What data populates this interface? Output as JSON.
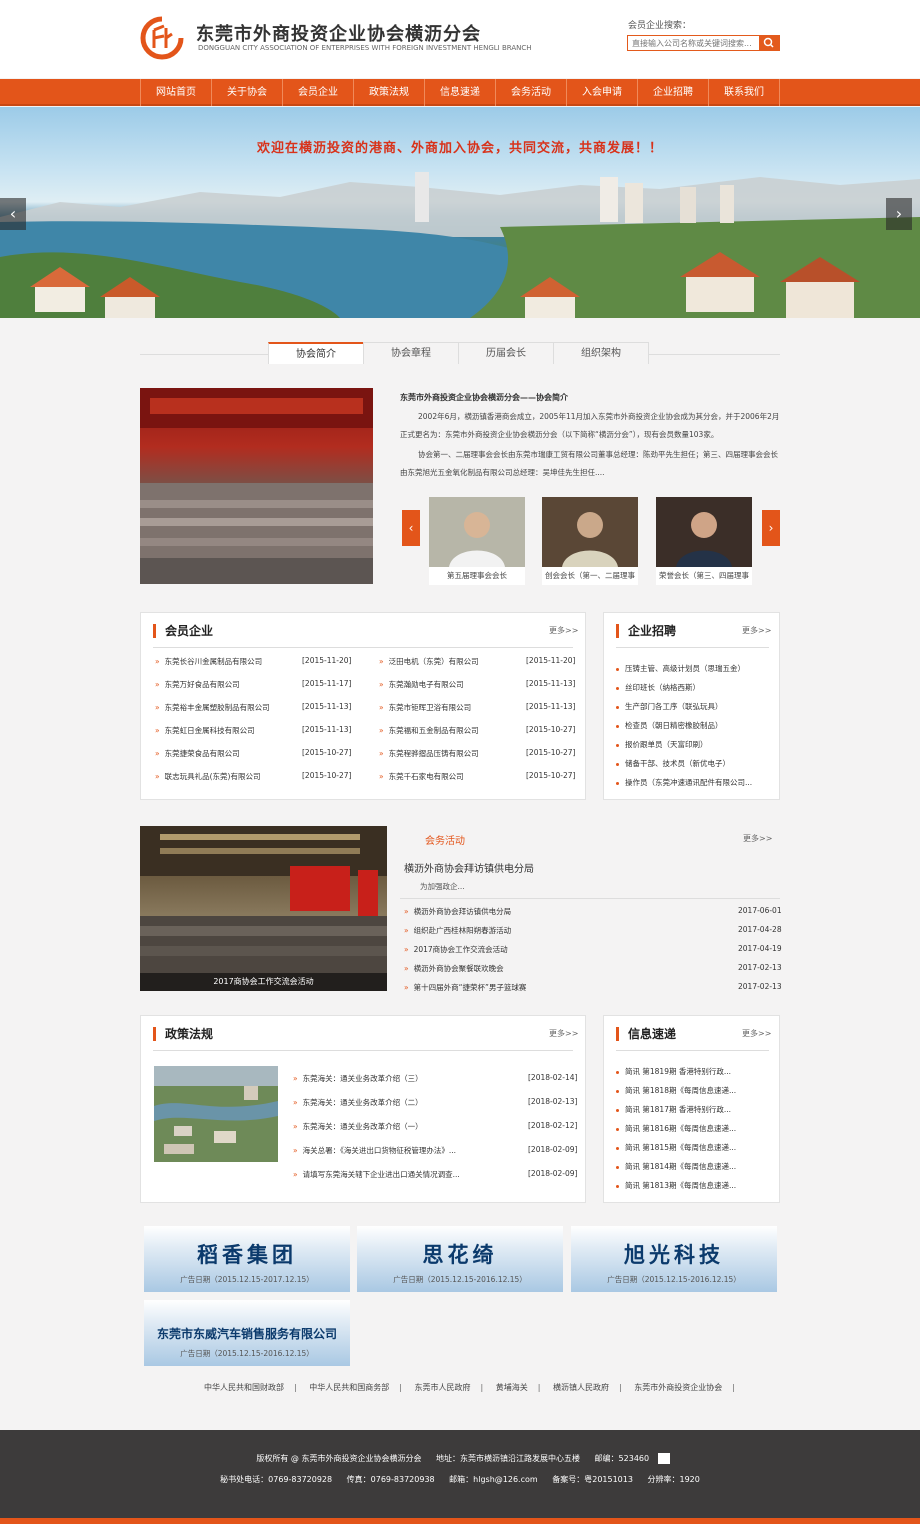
{
  "header": {
    "title": "东莞市外商投资企业协会横沥分会",
    "subtitle": "DONGGUAN CITY ASSOCIATION OF ENTERPRISES WITH FOREIGN INVESTMENT HENGLI BRANCH",
    "search_label": "会员企业搜索：",
    "search_placeholder": "直接输入公司名称或关键词搜索..."
  },
  "nav": [
    "网站首页",
    "关于协会",
    "会员企业",
    "政策法规",
    "信息速递",
    "会务活动",
    "入会申请",
    "企业招聘",
    "联系我们"
  ],
  "banner": {
    "slogan": "欢迎在横沥投资的港商、外商加入协会，共同交流，共商发展！！"
  },
  "tabs": [
    "协会简介",
    "协会章程",
    "历届会长",
    "组织架构"
  ],
  "intro": {
    "title": "东莞市外商投资企业协会横沥分会——协会简介",
    "p1": "2002年6月，横沥镇香港商会成立，2005年11月加入东莞市外商投资企业协会成为其分会，并于2006年2月正式更名为：东莞市外商投资企业协会横沥分会（以下简称“横沥分会”），现有会员数量103家。",
    "p2": "协会第一、二届理事会会长由东莞市瑞康工贸有限公司董事总经理：陈劲平先生担任；第三、四届理事会会长由东莞旭光五金氧化制品有限公司总经理：吴坤佳先生担任....",
    "people": [
      "第五届理事会会长",
      "创会会长（第一、二届理事",
      "荣誉会长（第三、四届理事"
    ]
  },
  "members": {
    "title": "会员企业",
    "more": "更多>>",
    "left": [
      {
        "name": "东莞长谷川金属制品有限公司",
        "date": "[2015-11-20]"
      },
      {
        "name": "东莞万好食品有限公司",
        "date": "[2015-11-17]"
      },
      {
        "name": "东莞裕丰金属塑胶制品有限公司",
        "date": "[2015-11-13]"
      },
      {
        "name": "东莞虹日金属科技有限公司",
        "date": "[2015-11-13]"
      },
      {
        "name": "东莞捷荣食品有限公司",
        "date": "[2015-10-27]"
      },
      {
        "name": "联志玩具礼品(东莞)有限公司",
        "date": "[2015-10-27]"
      }
    ],
    "right": [
      {
        "name": "泛田电机（东莞）有限公司",
        "date": "[2015-11-20]"
      },
      {
        "name": "东莞瀚勋电子有限公司",
        "date": "[2015-11-13]"
      },
      {
        "name": "东莞市钜晖卫浴有限公司",
        "date": "[2015-11-13]"
      },
      {
        "name": "东莞福和五金制品有限公司",
        "date": "[2015-10-27]"
      },
      {
        "name": "东莞程骅摺品压铸有限公司",
        "date": "[2015-10-27]"
      },
      {
        "name": "东莞千石家电有限公司",
        "date": "[2015-10-27]"
      }
    ]
  },
  "jobs": {
    "title": "企业招聘",
    "more": "更多>>",
    "items": [
      "压铸主管、高级计划员（思瑞五金）",
      "丝印班长（纳格西斯）",
      "生产部门各工序（联弘玩具）",
      "检查员（朝日精密橡胶制品）",
      "报价跟单员（天富印刷）",
      "储备干部、技术员（新优电子）",
      "操作员（东莞冲速通讯配件有限公司..."
    ]
  },
  "activities": {
    "title": "会务活动",
    "more": "更多>>",
    "headline": "横沥外商协会拜访镇供电分局",
    "summary": "为加强政企...",
    "photo_caption": "2017商协会工作交流会活动",
    "items": [
      {
        "name": "横沥外商协会拜访镇供电分局",
        "date": "2017-06-01"
      },
      {
        "name": "组织赴广西桂林阳朔春游活动",
        "date": "2017-04-28"
      },
      {
        "name": "2017商协会工作交流会活动",
        "date": "2017-04-19"
      },
      {
        "name": "横沥外商协会聚餐联欢晚会",
        "date": "2017-02-13"
      },
      {
        "name": "第十四届外商“捷荣杯”男子篮球赛",
        "date": "2017-02-13"
      }
    ]
  },
  "policy": {
    "title": "政策法规",
    "more": "更多>>",
    "items": [
      {
        "name": "东莞海关：通关业务改革介绍（三）",
        "date": "[2018-02-14]"
      },
      {
        "name": "东莞海关：通关业务改革介绍（二）",
        "date": "[2018-02-13]"
      },
      {
        "name": "东莞海关：通关业务改革介绍（一）",
        "date": "[2018-02-12]"
      },
      {
        "name": "海关总署：《海关进出口货物征税管理办法》...",
        "date": "[2018-02-09]"
      },
      {
        "name": "请填写东莞海关辖下企业进出口通关情况调查...",
        "date": "[2018-02-09]"
      }
    ]
  },
  "news": {
    "title": "信息速递",
    "more": "更多>>",
    "items": [
      "简讯 第1819期 香港特别行政...",
      "简讯 第1818期《每周信息速递...",
      "简讯 第1817期 香港特别行政...",
      "简讯 第1816期《每周信息速递...",
      "简讯 第1815期《每周信息速递...",
      "简讯 第1814期《每周信息速递...",
      "简讯 第1813期《每周信息速递..."
    ]
  },
  "ads": [
    {
      "name": "稻香集团",
      "date": "广告日期（2015.12.15-2017.12.15）"
    },
    {
      "name": "思花绮",
      "date": "广告日期（2015.12.15-2016.12.15）"
    },
    {
      "name": "旭光科技",
      "date": "广告日期（2015.12.15-2016.12.15）"
    },
    {
      "name": "东莞市东威汽车销售服务有限公司",
      "date": "广告日期（2015.12.15-2016.12.15）"
    }
  ],
  "links": [
    "中华人民共和国财政部",
    "中华人民共和国商务部",
    "东莞市人民政府",
    "黄埔海关",
    "横沥镇人民政府",
    "东莞市外商投资企业协会"
  ],
  "footer": {
    "copyright": "版权所有 @ 东莞市外商投资企业协会横沥分会",
    "address": "地址：东莞市横沥镇沿江路发展中心五楼",
    "zip": "邮编：523460",
    "phone": "秘书处电话：0769-83720928",
    "fax": "传真：0769-83720938",
    "email": "邮箱：hlgsh@126.com",
    "icp": "备案号：粤20151013",
    "resolution": "分辨率：1920"
  },
  "colors": {
    "accent": "#e3551a",
    "footer": "#3d3b3b",
    "ad_text": "#0b3a6c"
  }
}
